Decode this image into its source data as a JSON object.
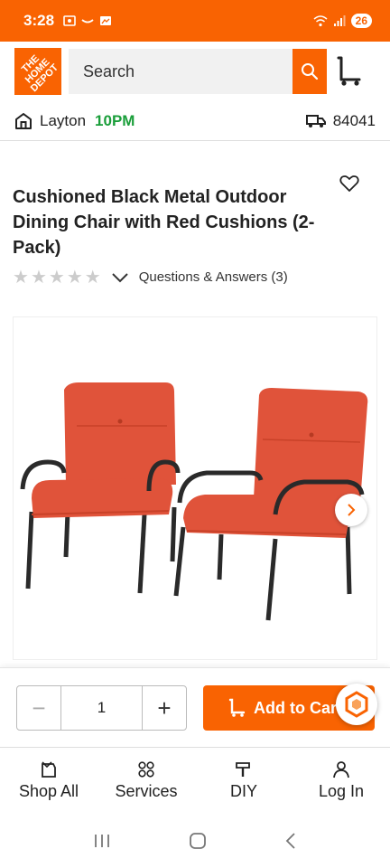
{
  "status_bar": {
    "time": "3:28",
    "battery": "26"
  },
  "header": {
    "logo_text": "THE HOME DEPOT",
    "search": {
      "placeholder": "Search"
    }
  },
  "store": {
    "name": "Layton",
    "hours": "10PM",
    "zip": "84041"
  },
  "product": {
    "title": "Cushioned Black Metal Outdoor Dining Chair with Red Cushions (2-Pack)",
    "rating_stars": 0,
    "qa_link": "Questions & Answers (3)"
  },
  "purchase": {
    "quantity": "1",
    "minus": "−",
    "plus": "+",
    "add_to_cart": "Add to Cart"
  },
  "bottom_nav": {
    "items": [
      {
        "label": "Shop All",
        "icon": "shop-all-icon"
      },
      {
        "label": "Services",
        "icon": "services-icon"
      },
      {
        "label": "DIY",
        "icon": "diy-icon"
      },
      {
        "label": "Log In",
        "icon": "user-icon"
      }
    ]
  },
  "colors": {
    "brand": "#f96302",
    "store_hours": "#1a9e3a",
    "cushion": "#e0533a"
  }
}
